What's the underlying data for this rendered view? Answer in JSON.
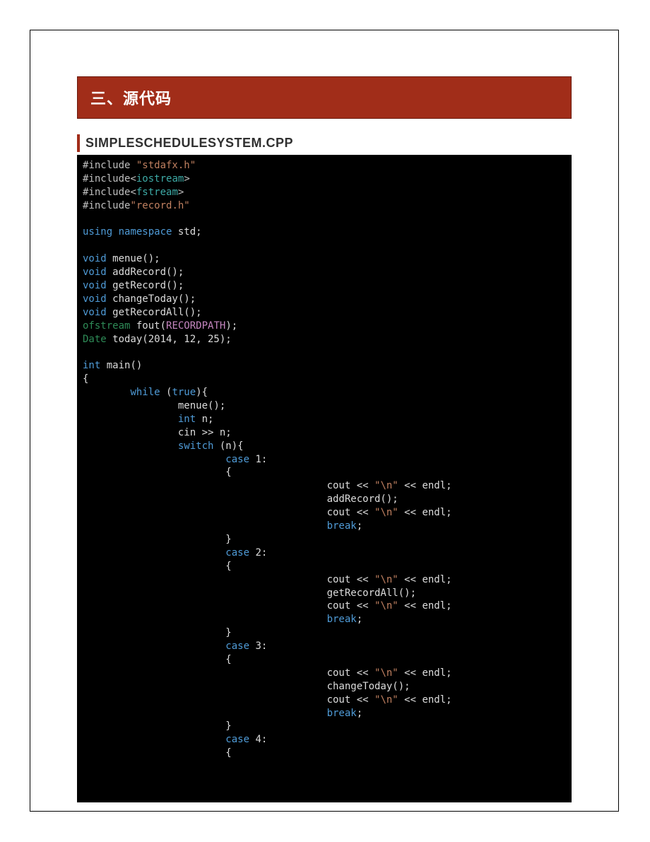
{
  "section_title": "三、源代码",
  "file_title": "SIMPLESCHEDULESYSTEM.CPP",
  "code_lines": [
    [
      [
        "pp",
        "#include "
      ],
      [
        "str",
        "\"stdafx.h\""
      ]
    ],
    [
      [
        "pp",
        "#include"
      ],
      [
        "punc",
        "<"
      ],
      [
        "cls",
        "iostream"
      ],
      [
        "punc",
        ">"
      ]
    ],
    [
      [
        "pp",
        "#include"
      ],
      [
        "punc",
        "<"
      ],
      [
        "cls",
        "fstream"
      ],
      [
        "punc",
        ">"
      ]
    ],
    [
      [
        "pp",
        "#include"
      ],
      [
        "str",
        "\"record.h\""
      ]
    ],
    [],
    [
      [
        "kw",
        "using"
      ],
      [
        "id",
        " "
      ],
      [
        "kw",
        "namespace"
      ],
      [
        "id",
        " std;"
      ]
    ],
    [],
    [
      [
        "kw",
        "void"
      ],
      [
        "id",
        " menue();"
      ]
    ],
    [
      [
        "kw",
        "void"
      ],
      [
        "id",
        " addRecord();"
      ]
    ],
    [
      [
        "kw",
        "void"
      ],
      [
        "id",
        " getRecord();"
      ]
    ],
    [
      [
        "kw",
        "void"
      ],
      [
        "id",
        " changeToday();"
      ]
    ],
    [
      [
        "kw",
        "void"
      ],
      [
        "id",
        " getRecordAll();"
      ]
    ],
    [
      [
        "type",
        "ofstream"
      ],
      [
        "id",
        " fout("
      ],
      [
        "def",
        "RECORDPATH"
      ],
      [
        "id",
        ");"
      ]
    ],
    [
      [
        "type",
        "Date"
      ],
      [
        "id",
        " today(2014, 12, 25);"
      ]
    ],
    [],
    [
      [
        "kw",
        "int"
      ],
      [
        "id",
        " main()"
      ]
    ],
    [
      [
        "id",
        "{"
      ]
    ],
    [
      [
        "id",
        "        "
      ],
      [
        "kw",
        "while"
      ],
      [
        "id",
        " ("
      ],
      [
        "kw",
        "true"
      ],
      [
        "id",
        "){"
      ]
    ],
    [
      [
        "id",
        "                menue();"
      ]
    ],
    [
      [
        "id",
        "                "
      ],
      [
        "kw",
        "int"
      ],
      [
        "id",
        " n;"
      ]
    ],
    [
      [
        "id",
        "                cin >> n;"
      ]
    ],
    [
      [
        "id",
        "                "
      ],
      [
        "kw",
        "switch"
      ],
      [
        "id",
        " (n){"
      ]
    ],
    [
      [
        "id",
        "                        "
      ],
      [
        "kw",
        "case"
      ],
      [
        "id",
        " 1:"
      ]
    ],
    [
      [
        "id",
        "                        {"
      ]
    ],
    [
      [
        "id",
        "                                         cout << "
      ],
      [
        "str",
        "\"\\n\""
      ],
      [
        "id",
        " << endl;"
      ]
    ],
    [
      [
        "id",
        "                                         addRecord();"
      ]
    ],
    [
      [
        "id",
        "                                         cout << "
      ],
      [
        "str",
        "\"\\n\""
      ],
      [
        "id",
        " << endl;"
      ]
    ],
    [
      [
        "id",
        "                                         "
      ],
      [
        "kw",
        "break"
      ],
      [
        "id",
        ";"
      ]
    ],
    [
      [
        "id",
        "                        }"
      ]
    ],
    [
      [
        "id",
        "                        "
      ],
      [
        "kw",
        "case"
      ],
      [
        "id",
        " 2:"
      ]
    ],
    [
      [
        "id",
        "                        {"
      ]
    ],
    [
      [
        "id",
        "                                         cout << "
      ],
      [
        "str",
        "\"\\n\""
      ],
      [
        "id",
        " << endl;"
      ]
    ],
    [
      [
        "id",
        "                                         getRecordAll();"
      ]
    ],
    [
      [
        "id",
        "                                         cout << "
      ],
      [
        "str",
        "\"\\n\""
      ],
      [
        "id",
        " << endl;"
      ]
    ],
    [
      [
        "id",
        "                                         "
      ],
      [
        "kw",
        "break"
      ],
      [
        "id",
        ";"
      ]
    ],
    [
      [
        "id",
        "                        }"
      ]
    ],
    [
      [
        "id",
        "                        "
      ],
      [
        "kw",
        "case"
      ],
      [
        "id",
        " 3:"
      ]
    ],
    [
      [
        "id",
        "                        {"
      ]
    ],
    [
      [
        "id",
        "                                         cout << "
      ],
      [
        "str",
        "\"\\n\""
      ],
      [
        "id",
        " << endl;"
      ]
    ],
    [
      [
        "id",
        "                                         changeToday();"
      ]
    ],
    [
      [
        "id",
        "                                         cout << "
      ],
      [
        "str",
        "\"\\n\""
      ],
      [
        "id",
        " << endl;"
      ]
    ],
    [
      [
        "id",
        "                                         "
      ],
      [
        "kw",
        "break"
      ],
      [
        "id",
        ";"
      ]
    ],
    [
      [
        "id",
        "                        }"
      ]
    ],
    [
      [
        "id",
        "                        "
      ],
      [
        "kw",
        "case"
      ],
      [
        "id",
        " 4:"
      ]
    ],
    [
      [
        "id",
        "                        {"
      ]
    ]
  ]
}
